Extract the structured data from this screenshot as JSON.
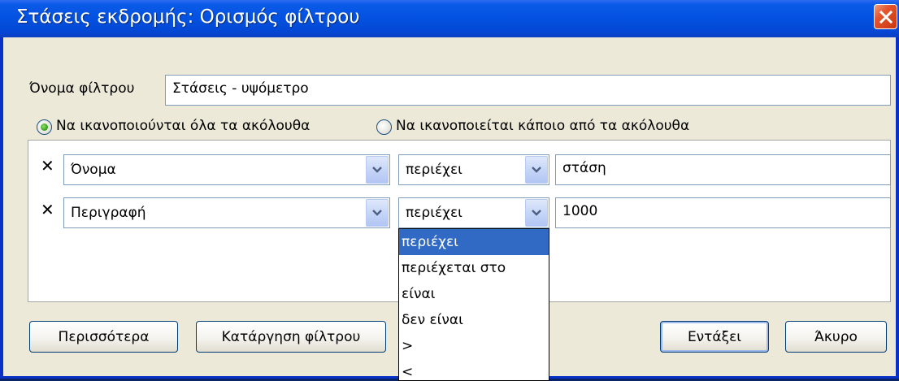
{
  "window": {
    "title": "Στάσεις εκδρομής: Ορισμός φίλτρου"
  },
  "filter_name": {
    "label": "Όνομα φίλτρου",
    "value": "Στάσεις - υψόμετρο"
  },
  "match_mode": {
    "all_label": "Να ικανοποιούνται όλα τα ακόλουθα",
    "any_label": "Να ικανοποιείται κάποιο από τα ακόλουθα",
    "selected": "all"
  },
  "rules": [
    {
      "field": "Όνομα",
      "operator": "περιέχει",
      "value": "στάση"
    },
    {
      "field": "Περιγραφή",
      "operator": "περιέχει",
      "value": "1000"
    }
  ],
  "operator_dropdown": {
    "options": [
      "περιέχει",
      "περιέχεται στο",
      "είναι",
      "δεν είναι",
      ">",
      "<"
    ],
    "selected": "περιέχει"
  },
  "buttons": {
    "more": "Περισσότερα",
    "remove_filter": "Κατάργηση φίλτρου",
    "ok": "Εντάξει",
    "cancel": "Άκυρο"
  },
  "icons": {
    "close": "close-icon",
    "delete_rule": "delete-rule-icon",
    "dropdown_arrow": "chevron-down-icon"
  }
}
